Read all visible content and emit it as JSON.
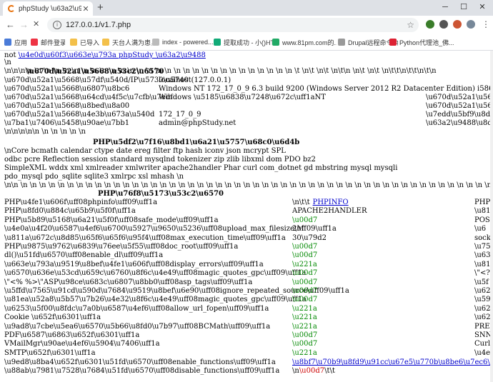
{
  "browser": {
    "tab_title": "phpStudy \\u63a2\\u9488 2014",
    "address": "127.0.0.1/v1.7.php",
    "bookmarks": [
      "应用",
      "邮件登录",
      "已导入",
      "天台人满为患，不...",
      "index - powered...",
      "提取成功 - 小()HT...",
      "www.81pm.com的...",
      "Drupal远程命令执...",
      "Python代理池_佛..."
    ]
  },
  "top": {
    "not_prefix": "not ",
    "not_link": "\\u4e0d\\u60f3\\u663e\\u793a phpStudy \\u63a2\\u9488",
    "line_n": "\\n",
    "line_nn": "\\n\\n\\n\\n \\n \\n \\n \\n \\n \\n \\n \\n \\n \\n \\n \\n \\n \\n \\n \\n \\n \\n \\n \\n \\n \\n \\n \\n \\n \\n \\n \\n \\t \\n\\t \\n\\t \\n\\t\\n \\n\\t \\n\\t \\n\\t\\t\\n\\t\\t\\n\\t\\n",
    "heading": "\\u670d\\u52a1\\u5668\\u53c2\\u6570"
  },
  "server_rows": [
    {
      "label": "\\u670d\\u52a1\\u5668\\u57df\\u540d/IP\\u5730\\u5740",
      "value": "localhost(127.0.0.1)",
      "right": ""
    },
    {
      "label": "\\u670d\\u52a1\\u5668\\u6807\\u8bc6",
      "value": "Windows NT 172_17_0_9 6.3 build 9200 (Windows Server 2012 R2 Datacenter Edition) i586",
      "right": ""
    },
    {
      "label": "\\u670d\\u52a1\\u5668\\u64cd\\u4f5c\\u7cfb\\u7edf",
      "value": "Windows  \\u5185\\u6838\\u7248\\u672c\\uff1aNT",
      "right": "\\u670d\\u52a1\\u5668"
    },
    {
      "label": "\\u670d\\u52a1\\u5668\\u8bed\\u8a00",
      "value": "",
      "right": "\\u670d\\u52a1\\u5668"
    },
    {
      "label": "\\u670d\\u52a1\\u5668\\u4e3b\\u673a\\u540d",
      "value": "172_17_0_9",
      "right": "\\u7edd\\u5bf9\\u8def"
    },
    {
      "label": "\\u7ba1\\u7406\\u5458\\u90ae\\u7bb1",
      "value": "admin@phpStudy.net",
      "right": "\\u63a2\\u9488\\u8def"
    }
  ],
  "server_tail": "\\n\\n\\n\\n\\n \\n \\n \\n \\n \\n",
  "ext": {
    "heading": "PHP\\u5df2\\u7f16\\u8bd1\\u6a21\\u5757\\u68c0\\u6d4b",
    "lines": [
      "\\nCore  bcmath  calendar  ctype  date  ereg  filter  ftp  hash  iconv  json  mcrypt  SPL",
      "odbc  pcre  Reflection  session  standard  mysqlnd  tokenizer  zip  zlib  libxml  dom  PDO  bz2",
      "SimpleXML  wddx  xml  xmlreader  xmlwriter  apache2handler  Phar  curl  com_dotnet  gd  mbstring  mysql  mysqli",
      "pdo_mysql  pdo_sqlite  sqlite3  xmlrpc  xsl  mhash  \\n"
    ],
    "tail": "\\n\\n \\n \\n \\n \\n \\n \\n \\n \\n \\n \\n \\n \\n \\n \\n \\n \\n \\n \\n \\n \\n \\n \\n \\n \\n \\n \\n \\n \\n \\n \\n \\n \\n \\n \\n \\n \\n \\n \\n \\n \\n \\n \\n \\n \\n \\n \\n \\n \\n \\n \\n \\n \\n \\n \\n \\n \\n"
  },
  "php": {
    "heading": "PHP\\u76f8\\u5173\\u53c2\\u6570",
    "rows": [
      {
        "label": "PHP\\u4fe1\\u606f\\uff08phpinfo\\uff09\\uff1a",
        "value": "\\n\\t\\t",
        "link": "PHPINFO",
        "color": "black",
        "right": "PHP"
      },
      {
        "label": "PHP\\u8fd0\\u884c\\u65b9\\u5f0f\\uff1a",
        "value": "APACHE2HANDLER",
        "link": "",
        "color": "black",
        "right": "\\u81"
      },
      {
        "label": "PHP\\u5b89\\u5168\\u6a21\\u5f0f\\uff08safe_mode\\uff09\\uff1a",
        "value": "\\u00d7",
        "link": "",
        "color": "green",
        "right": "POS"
      },
      {
        "label": "\\u4e0a\\u4f20\\u6587\\u4ef6\\u6700\\u5927\\u9650\\u5236\\uff08upload_max_filesize\\uff09\\uff1a",
        "value": "2M",
        "link": "",
        "color": "black",
        "right": "\\u6"
      },
      {
        "label": "\\u811a\\u672c\\u8d85\\u65f6\\u65f6\\u95f4\\uff08max_execution_time\\uff09\\uff1a",
        "value": "30\\u79d2",
        "link": "",
        "color": "black",
        "right": "sock"
      },
      {
        "label": "PHP\\u9875\\u9762\\u6839\\u76ee\\u5f55\\uff08doc_root\\uff09\\uff1a",
        "value": "\\u00d7",
        "link": "",
        "color": "green",
        "right": "\\u75"
      },
      {
        "label": "dl()\\u51fd\\u6570\\uff08enable_dl\\uff09\\uff1a",
        "value": "\\u00d7",
        "link": "",
        "color": "green",
        "right": "\\u63"
      },
      {
        "label": "\\u663e\\u793a\\u9519\\u8bef\\u4fe1\\u606f\\uff08display_errors\\uff09\\uff1a",
        "value": "\\u221a",
        "link": "",
        "color": "green",
        "right": "\\u81"
      },
      {
        "label": "\\u6570\\u636e\\u53cd\\u659c\\u6760\\u8f6c\\u4e49\\uff08magic_quotes_gpc\\uff09\\uff1a",
        "value": "\\u00d7",
        "link": "",
        "color": "green",
        "right": "\\\"<?"
      },
      {
        "label": "\\\"<% %>\\\"ASP\\u98ce\\u683c\\u6807\\u8bb0\\uff08asp_tags\\uff09\\uff1a",
        "value": "\\u00d7",
        "link": "",
        "color": "green",
        "right": "\\u5f"
      },
      {
        "label": "\\u5ffd\\u7565\\u91cd\\u590d\\u7684\\u9519\\u8bef\\u6e90\\uff08ignore_repeated_source\\uff09\\uff1a",
        "value": "\\u00d7",
        "link": "",
        "color": "green",
        "right": "\\u62"
      },
      {
        "label": "\\u81ea\\u52a8\\u5b57\\u7b26\\u4e32\\u8f6c\\u4e49\\uff08magic_quotes_gpc\\uff09\\uff1a",
        "value": "\\u00d7",
        "link": "",
        "color": "green",
        "right": "\\u59"
      },
      {
        "label": "\\u6253\\u5f00\\u8fdc\\u7a0b\\u6587\\u4ef6\\uff08allow_url_fopen\\uff09\\uff1a",
        "value": "\\u221a",
        "link": "",
        "color": "green",
        "right": "\\u62"
      },
      {
        "label": "Cookie \\u652f\\u6301\\uff1a",
        "value": "\\u221a",
        "link": "",
        "color": "green",
        "right": "\\u62"
      },
      {
        "label": "\\u9ad8\\u7cbe\\u5ea6\\u6570\\u5b66\\u8fd0\\u7b97\\uff08BCMath\\uff09\\uff1a",
        "value": "\\u221a",
        "link": "",
        "color": "green",
        "right": "PRE"
      },
      {
        "label": "PDF\\u6587\\u6863\\u652f\\u6301\\uff1a",
        "value": "\\u00d7",
        "link": "",
        "color": "green",
        "right": "SNN"
      },
      {
        "label": "VMailMgr\\u90ae\\u4ef6\\u5904\\u7406\\uff1a",
        "value": "\\u00d7",
        "link": "",
        "color": "green",
        "right": "Curl"
      },
      {
        "label": "SMTP\\u652f\\u6301\\uff1a",
        "value": "\\u221a",
        "link": "",
        "color": "green",
        "right": "\\u4e"
      }
    ],
    "enable_functions": {
      "label": "\\u9ed8\\u8ba4\\u652f\\u6301\\u51fd\\u6570\\uff08enable_functions\\uff09\\uff1a",
      "link": "\\u8bf7\\u70b9\\u8fd9\\u91cc\\u67e5\\u770b\\u8be6\\u7ec6\\uff01"
    },
    "disable_functions": {
      "label": "\\u88ab\\u7981\\u7528\\u7684\\u51fd\\u6570\\uff08disable_functions\\uff09\\uff1a",
      "value_prefix": "\\n",
      "value_red": "\\u00d7",
      "value_suffix": "\\t\\t"
    }
  }
}
